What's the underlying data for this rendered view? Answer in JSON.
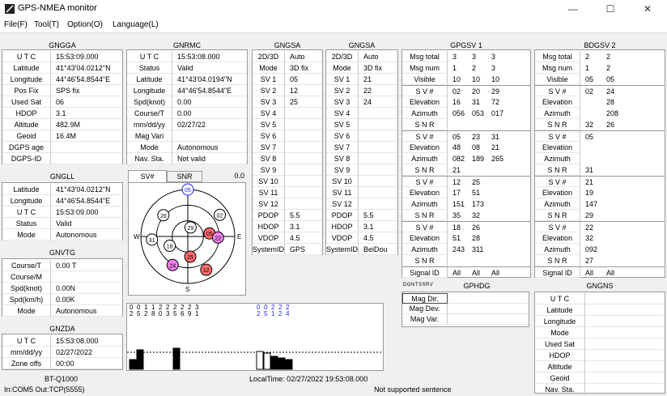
{
  "window": {
    "title": "GPS-NMEA monitor",
    "minimize": "—",
    "maximize": "☐",
    "close": "✕"
  },
  "menu": [
    "File(F)",
    "Tool(T)",
    "Option(O)",
    "Language(L)"
  ],
  "gngga": {
    "title": "GNGGA",
    "rows": [
      [
        "U T C",
        "15:53:09.000"
      ],
      [
        "Latitude",
        "41°43'04.0212\"N"
      ],
      [
        "Longitude",
        "44°46'54.8544\"E"
      ],
      [
        "Pos Fix",
        "SPS fix"
      ],
      [
        "Used Sat",
        "06"
      ],
      [
        "HDOP",
        "3.1"
      ],
      [
        "Altitude",
        "482.9M"
      ],
      [
        "Geoid",
        "16.4M"
      ],
      [
        "DGPS age",
        ""
      ],
      [
        "DGPS-ID",
        ""
      ]
    ]
  },
  "gnrmc": {
    "title": "GNRMC",
    "rows": [
      [
        "U T C",
        "15:53:08.000"
      ],
      [
        "Status",
        "Valid"
      ],
      [
        "Latitude",
        "41°43'04.0194\"N"
      ],
      [
        "Longitude",
        "44°46'54.8544\"E"
      ],
      [
        "Spd(knot)",
        "0.00"
      ],
      [
        "Course/T",
        "0.00"
      ],
      [
        "mm/dd/yy",
        "02/27/22"
      ],
      [
        "Mag Vari",
        ""
      ],
      [
        "Mode",
        "Autonomous"
      ],
      [
        "Nav. Sta.",
        "Not valid"
      ]
    ]
  },
  "gngsa1": {
    "title": "GNGSA",
    "rows": [
      [
        "2D/3D",
        "Auto"
      ],
      [
        "Mode",
        "3D fix"
      ],
      [
        "SV  1",
        "05"
      ],
      [
        "SV  2",
        "12"
      ],
      [
        "SV  3",
        "25"
      ],
      [
        "SV  4",
        ""
      ],
      [
        "SV  5",
        ""
      ],
      [
        "SV  6",
        ""
      ],
      [
        "SV  7",
        ""
      ],
      [
        "SV  8",
        ""
      ],
      [
        "SV  9",
        ""
      ],
      [
        "SV 10",
        ""
      ],
      [
        "SV 11",
        ""
      ],
      [
        "SV 12",
        ""
      ],
      [
        "PDOP",
        "5.5"
      ],
      [
        "HDOP",
        "3.1"
      ],
      [
        "VDOP",
        "4.5"
      ],
      [
        "SystemID",
        "GPS"
      ]
    ]
  },
  "gngsa2": {
    "title": "GNGSA",
    "rows": [
      [
        "2D/3D",
        "Auto"
      ],
      [
        "Mode",
        "3D fix"
      ],
      [
        "SV  1",
        "21"
      ],
      [
        "SV  2",
        "22"
      ],
      [
        "SV  3",
        "24"
      ],
      [
        "SV  4",
        ""
      ],
      [
        "SV  5",
        ""
      ],
      [
        "SV  6",
        ""
      ],
      [
        "SV  7",
        ""
      ],
      [
        "SV  8",
        ""
      ],
      [
        "SV  9",
        ""
      ],
      [
        "SV 10",
        ""
      ],
      [
        "SV 11",
        ""
      ],
      [
        "SV 12",
        ""
      ],
      [
        "PDOP",
        "5.5"
      ],
      [
        "HDOP",
        "3.1"
      ],
      [
        "VDOP",
        "4.5"
      ],
      [
        "SystemID",
        "BeiDou"
      ]
    ]
  },
  "gpgsv": {
    "title": "GPGSV 1",
    "header": [
      [
        "Msg total",
        "3",
        "3",
        "3"
      ],
      [
        "Msg num",
        "1",
        "2",
        "3"
      ],
      [
        "Visible",
        "10",
        "10",
        "10"
      ]
    ],
    "groups": [
      [
        [
          "S V #",
          "02",
          "20",
          "29"
        ],
        [
          "Elevation",
          "16",
          "31",
          "72"
        ],
        [
          "Azimuth",
          "056",
          "053",
          "017"
        ],
        [
          "S N R",
          "",
          "",
          ""
        ]
      ],
      [
        [
          "S V #",
          "05",
          "23",
          "31"
        ],
        [
          "Elevation",
          "48",
          "08",
          "21"
        ],
        [
          "Azimuth",
          "082",
          "189",
          "265"
        ],
        [
          "S N R",
          "21",
          "",
          ""
        ]
      ],
      [
        [
          "S V #",
          "12",
          "25",
          ""
        ],
        [
          "Elevation",
          "17",
          "51",
          ""
        ],
        [
          "Azimuth",
          "151",
          "173",
          ""
        ],
        [
          "S N R",
          "35",
          "32",
          ""
        ]
      ],
      [
        [
          "S V #",
          "18",
          "26",
          ""
        ],
        [
          "Elevation",
          "51",
          "28",
          ""
        ],
        [
          "Azimuth",
          "243",
          "311",
          ""
        ],
        [
          "S N R",
          "",
          "",
          ""
        ]
      ]
    ],
    "footer": [
      "Signal ID",
      "All",
      "All",
      "All"
    ]
  },
  "bdgsv": {
    "title": "BDGSV 2",
    "header": [
      [
        "Msg total",
        "2",
        "2"
      ],
      [
        "Msg num",
        "1",
        "2"
      ],
      [
        "Visible",
        "05",
        "05"
      ]
    ],
    "groups": [
      [
        [
          "S V #",
          "02",
          "24"
        ],
        [
          "Elevation",
          "",
          "28"
        ],
        [
          "Azimuth",
          "",
          "208"
        ],
        [
          "S N R",
          "32",
          "26"
        ]
      ],
      [
        [
          "S V #",
          "05",
          ""
        ],
        [
          "Elevation",
          "",
          ""
        ],
        [
          "Azimuth",
          "",
          ""
        ],
        [
          "S N R",
          "31",
          ""
        ]
      ],
      [
        [
          "S V #",
          "21",
          ""
        ],
        [
          "Elevation",
          "19",
          ""
        ],
        [
          "Azimuth",
          "147",
          ""
        ],
        [
          "S N R",
          "29",
          ""
        ]
      ],
      [
        [
          "S V #",
          "22",
          ""
        ],
        [
          "Elevation",
          "32",
          ""
        ],
        [
          "Azimuth",
          "092",
          ""
        ],
        [
          "S N R",
          "27",
          ""
        ]
      ]
    ],
    "footer": [
      "Signal ID",
      "All",
      "All"
    ]
  },
  "gngll": {
    "title": "GNGLL",
    "rows": [
      [
        "Latitude",
        "41°43'04.0212\"N"
      ],
      [
        "Longitude",
        "44°46'54.8544\"E"
      ],
      [
        "U T C",
        "15:53:09.000"
      ],
      [
        "Status",
        "Valid"
      ],
      [
        "Mode",
        "Autonomous"
      ]
    ]
  },
  "gnvtg": {
    "title": "GNVTG",
    "rows": [
      [
        "Course/T",
        "0.00 T"
      ],
      [
        "Course/M",
        ""
      ],
      [
        "Spd(knot)",
        "0.00N"
      ],
      [
        "Spd(km/h)",
        "0.00K"
      ],
      [
        "Mode",
        "Autonomous"
      ]
    ]
  },
  "gnzda": {
    "title": "GNZDA",
    "rows": [
      [
        "U T C",
        "15:53:08.000"
      ],
      [
        "mm/dd/yy",
        "02/27/2022"
      ],
      [
        "Zone offs",
        "00:00"
      ]
    ]
  },
  "skyview": {
    "tabs": [
      "SV#",
      "SNR"
    ],
    "value": "0.0",
    "compass": {
      "n": "N",
      "e": "E",
      "s": "S",
      "w": "W"
    },
    "sats": [
      {
        "id": "05",
        "el": 48,
        "az": 82,
        "color": "#ff6b6b"
      },
      {
        "id": "22",
        "el": 32,
        "az": 92,
        "color": "#f080f0"
      },
      {
        "id": "25",
        "el": 51,
        "az": 173,
        "color": "#ff6b6b"
      },
      {
        "id": "12",
        "el": 17,
        "az": 151,
        "color": "#ff6b6b"
      },
      {
        "id": "24",
        "el": 28,
        "az": 208,
        "color": "#f080f0"
      },
      {
        "id": "02",
        "el": 16,
        "az": 56,
        "color": "#ffffff"
      },
      {
        "id": "29",
        "el": 72,
        "az": 17,
        "color": "#ffffff"
      },
      {
        "id": "18",
        "el": 51,
        "az": 243,
        "color": "#ffffff"
      },
      {
        "id": "31",
        "el": 21,
        "az": 265,
        "color": "#ffffff"
      },
      {
        "id": "26",
        "el": 28,
        "az": 311,
        "color": "#ffffff"
      },
      {
        "id": "05",
        "el": 0,
        "az": 0,
        "color": "#ffffff",
        "ring": "#2020ff"
      }
    ]
  },
  "snr": {
    "black": [
      "02",
      "05",
      "12",
      "18",
      "20",
      "23",
      "25",
      "26",
      "29",
      "31"
    ],
    "blue": [
      "02",
      "05",
      "21",
      "22",
      "24"
    ],
    "bars": [
      {
        "h": 12,
        "fill": "#000"
      },
      {
        "h": 24,
        "fill": "#000"
      },
      {
        "h": 0,
        "fill": "#000"
      },
      {
        "h": 0,
        "fill": "#000"
      },
      {
        "h": 0,
        "fill": "#000"
      },
      {
        "h": 0,
        "fill": "#000"
      },
      {
        "h": 26,
        "fill": "#000"
      },
      {
        "h": 0,
        "fill": "#000"
      },
      {
        "h": 0,
        "fill": "#000"
      },
      {
        "h": 0,
        "fill": "#000"
      },
      {
        "h": 22,
        "fill": "#fff"
      },
      {
        "h": 20,
        "fill": "#fff"
      },
      {
        "h": 16,
        "fill": "#000"
      },
      {
        "h": 14,
        "fill": "#000"
      },
      {
        "h": 12,
        "fill": "#000"
      }
    ]
  },
  "gphdg": {
    "title": "GPHDG",
    "prefix": "DGNTSSRV",
    "rows": [
      [
        "Mag Dir.",
        ""
      ],
      [
        "Mag Dev.",
        ""
      ],
      [
        "Mag Var.",
        ""
      ]
    ]
  },
  "gngns": {
    "title": "GNGNS",
    "rows": [
      [
        "U T C",
        ""
      ],
      [
        "Latitude",
        ""
      ],
      [
        "Longitude",
        ""
      ],
      [
        "Mode",
        ""
      ],
      [
        "Used Sat",
        ""
      ],
      [
        "HDOP",
        ""
      ],
      [
        "Altitude",
        ""
      ],
      [
        "Geoid",
        ""
      ],
      [
        "Nav. Sta.",
        ""
      ]
    ]
  },
  "status": {
    "device": "BT-Q1000",
    "ports": "In:COM5  Out:TCP(5555)",
    "local_time": "LocalTime: 02/27/2022 19:53:08.000",
    "message": "Not supported sentence"
  }
}
